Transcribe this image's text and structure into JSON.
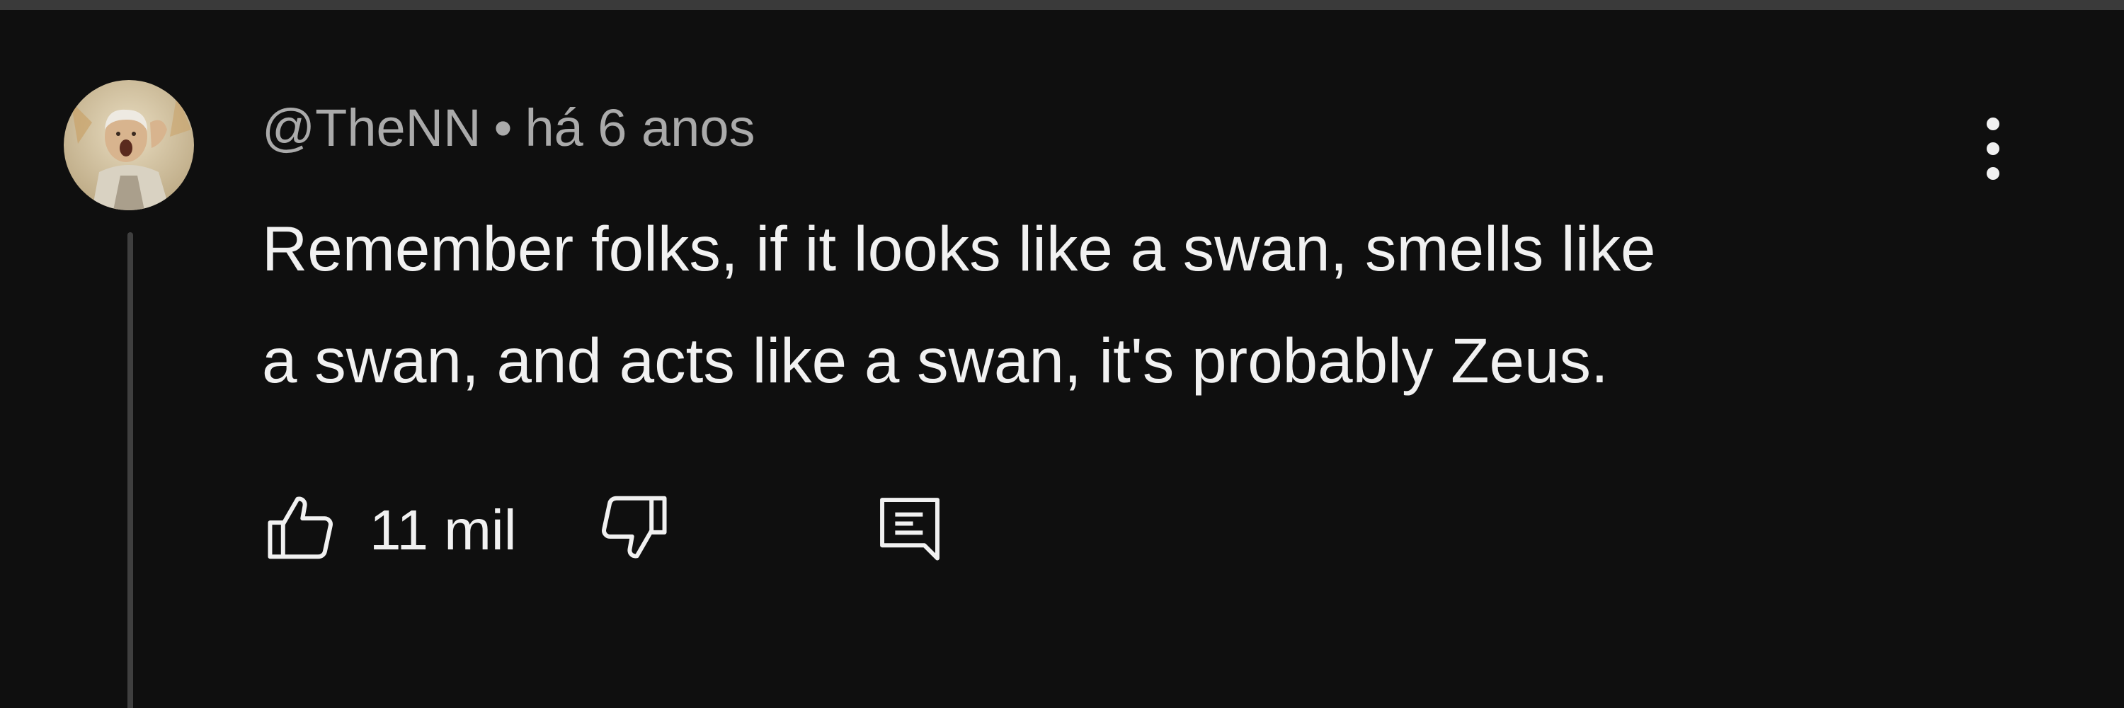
{
  "comment": {
    "author": "@TheNN",
    "separator": "•",
    "timestamp": "há 6 anos",
    "text_lines": [
      "Remember folks, if it looks like a swan, smells like",
      "a swan, and acts like a swan, it's probably Zeus."
    ]
  },
  "actions": {
    "like_count": "11 mil",
    "like_icon": "thumbs-up-icon",
    "dislike_icon": "thumbs-down-icon",
    "reply_icon": "reply-comment-icon",
    "menu_icon": "more-vert-icon"
  },
  "colors": {
    "background": "#0f0f0f",
    "primary_text": "#f1f1f1",
    "secondary_text": "#aaaaaa",
    "thread_line": "#3f3f3f"
  }
}
